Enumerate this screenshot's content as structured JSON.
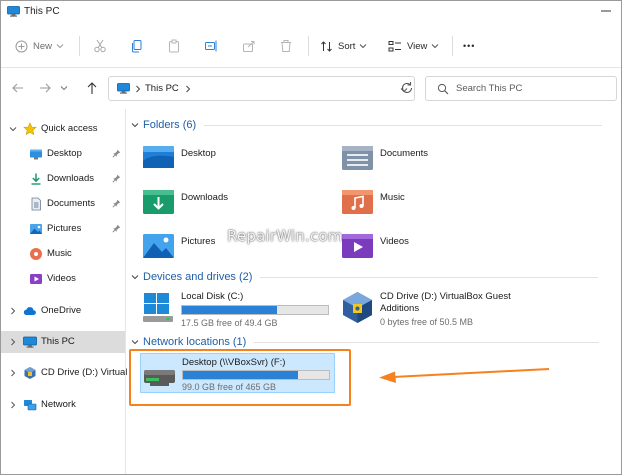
{
  "window": {
    "title": "This PC"
  },
  "toolbar": {
    "new_label": "New",
    "sort_label": "Sort",
    "view_label": "View",
    "more_label": "•••"
  },
  "address": {
    "crumb": "This PC",
    "search_placeholder": "Search This PC"
  },
  "sidebar": {
    "items": [
      {
        "label": "Quick access",
        "icon": "star-icon"
      },
      {
        "label": "Desktop",
        "icon": "desktop-folder-icon",
        "pinned": true
      },
      {
        "label": "Downloads",
        "icon": "download-icon",
        "pinned": true
      },
      {
        "label": "Documents",
        "icon": "documents-icon",
        "pinned": true
      },
      {
        "label": "Pictures",
        "icon": "pictures-icon",
        "pinned": true
      },
      {
        "label": "Music",
        "icon": "music-icon"
      },
      {
        "label": "Videos",
        "icon": "videos-icon"
      },
      {
        "label": "OneDrive",
        "icon": "cloud-icon"
      },
      {
        "label": "This PC",
        "icon": "computer-icon",
        "selected": true
      },
      {
        "label": "CD Drive (D:) Virtual",
        "icon": "virtualbox-icon"
      },
      {
        "label": "Network",
        "icon": "network-icon"
      }
    ]
  },
  "folders_header": "Folders (6)",
  "folders": [
    {
      "label": "Desktop",
      "icon": "desktop-folder-icon"
    },
    {
      "label": "Documents",
      "icon": "documents-folder-icon"
    },
    {
      "label": "Downloads",
      "icon": "downloads-folder-icon"
    },
    {
      "label": "Music",
      "icon": "music-folder-icon"
    },
    {
      "label": "Pictures",
      "icon": "pictures-folder-icon"
    },
    {
      "label": "Videos",
      "icon": "videos-folder-icon"
    }
  ],
  "devices_header": "Devices and drives (2)",
  "drives": [
    {
      "name": "Local Disk (C:)",
      "free": "17.5 GB free of 49.4 GB",
      "used_fraction": 0.65,
      "icon": "windows-drive-icon"
    },
    {
      "name": "CD Drive (D:) VirtualBox Guest",
      "name2": "Additions",
      "free": "0 bytes free of 50.5 MB",
      "icon": "virtualbox-cd-icon"
    }
  ],
  "network_header": "Network locations (1)",
  "network_drives": [
    {
      "name": "Desktop (\\\\VBoxSvr) (F:)",
      "free": "99.0 GB free of 465 GB",
      "used_fraction": 0.79,
      "icon": "network-drive-icon"
    }
  ],
  "watermark": "RepairWin.com",
  "colors": {
    "accent": "#2a82d7",
    "group_title": "#1e5fa8",
    "selection": "#cce8ff",
    "annotation": "#f5821f"
  }
}
